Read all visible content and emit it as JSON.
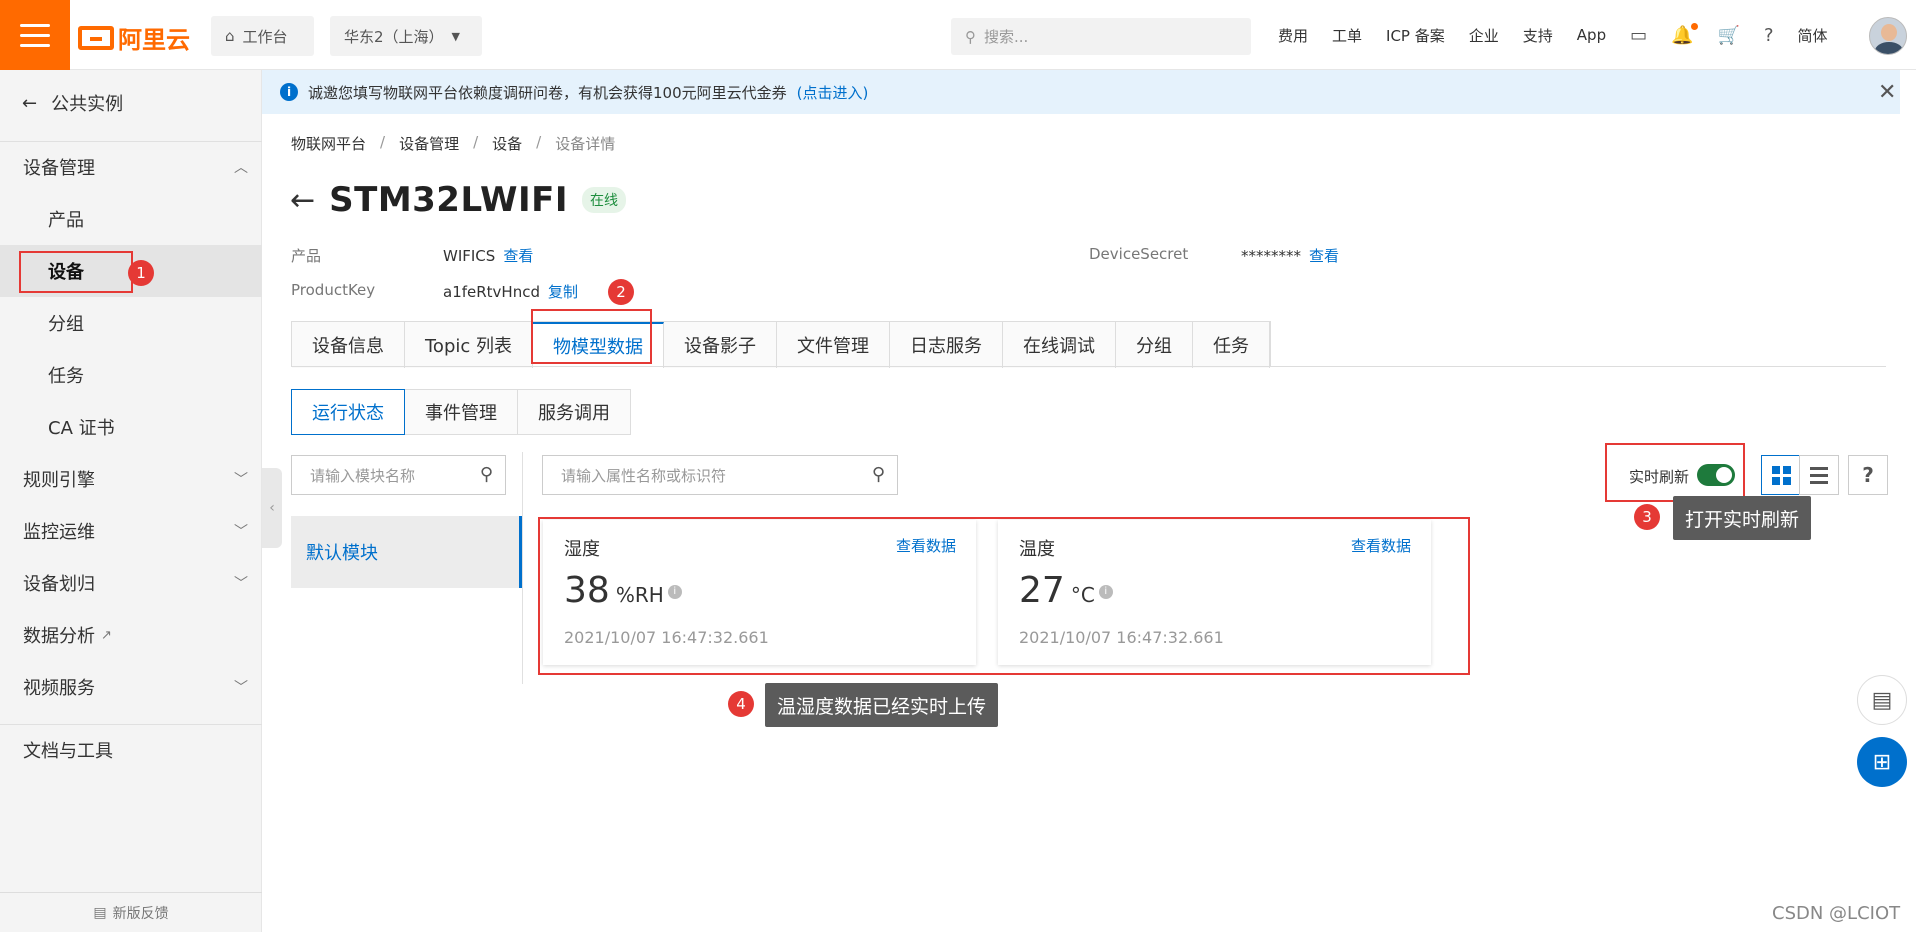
{
  "topbar": {
    "brand": "阿里云",
    "workbench": "工作台",
    "region": "华东2（上海）",
    "search_placeholder": "搜索...",
    "links": [
      "费用",
      "工单",
      "ICP 备案",
      "企业",
      "支持",
      "App"
    ],
    "lang": "简体"
  },
  "sidebar": {
    "back_label": "公共实例",
    "group_device_mgmt": "设备管理",
    "items": [
      "产品",
      "设备",
      "分组",
      "任务",
      "CA 证书"
    ],
    "sections": [
      "规则引擎",
      "监控运维",
      "设备划归",
      "数据分析",
      "视频服务"
    ],
    "docs": "文档与工具",
    "feedback": "新版反馈"
  },
  "notice": {
    "text": "诚邀您填写物联网平台依赖度调研问卷，有机会获得100元阿里云代金券",
    "link": "(点击进入)"
  },
  "breadcrumb": [
    "物联网平台",
    "设备管理",
    "设备",
    "设备详情"
  ],
  "device": {
    "name": "STM32LWIFI",
    "status": "在线",
    "product_label": "产品",
    "product_value": "WIFICS",
    "product_action": "查看",
    "productkey_label": "ProductKey",
    "productkey_value": "a1feRtvHncd",
    "productkey_action": "复制",
    "secret_label": "DeviceSecret",
    "secret_value": "********",
    "secret_action": "查看"
  },
  "tabs": [
    "设备信息",
    "Topic 列表",
    "物模型数据",
    "设备影子",
    "文件管理",
    "日志服务",
    "在线调试",
    "分组",
    "任务"
  ],
  "subtabs": [
    "运行状态",
    "事件管理",
    "服务调用"
  ],
  "filters": {
    "module_placeholder": "请输入模块名称",
    "attr_placeholder": "请输入属性名称或标识符"
  },
  "module": "默认模块",
  "realtime_label": "实时刷新",
  "cards": [
    {
      "title": "湿度",
      "link": "查看数据",
      "value": "38",
      "unit": "%RH",
      "time": "2021/10/07 16:47:32.661"
    },
    {
      "title": "温度",
      "link": "查看数据",
      "value": "27",
      "unit": "°C",
      "time": "2021/10/07 16:47:32.661"
    }
  ],
  "annotations": {
    "n1": "1",
    "n2": "2",
    "n3": "3",
    "n4": "4",
    "tip3": "打开实时刷新",
    "tip4": "温湿度数据已经实时上传"
  },
  "watermark": "CSDN @LCIOT",
  "colors": {
    "brand": "#ff6a00",
    "link": "#0070cc",
    "annotation": "#e53935",
    "toggle": "#1e7a3c"
  }
}
